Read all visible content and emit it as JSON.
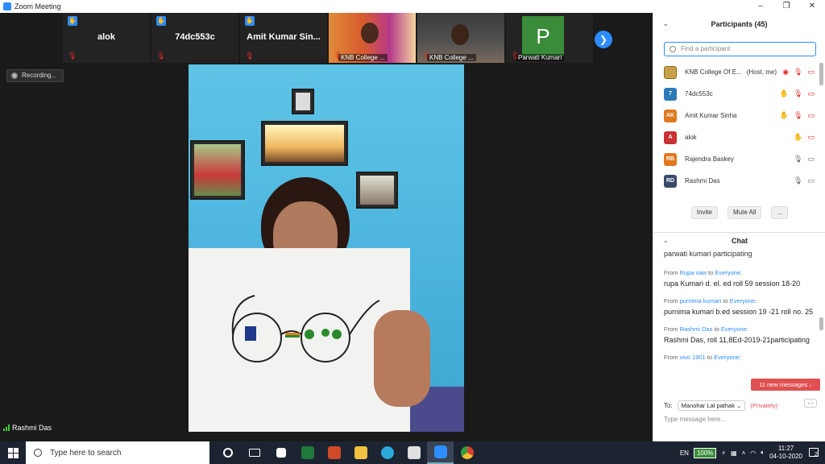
{
  "window": {
    "title": "Zoom Meeting"
  },
  "thumbnails": [
    {
      "name": "alok",
      "hand_raised": true,
      "muted": true
    },
    {
      "name": "74dc553c",
      "hand_raised": true,
      "muted": true
    },
    {
      "name": "Amit Kumar Sin...",
      "hand_raised": true,
      "muted": true
    },
    {
      "name": "KNB College ...",
      "video": true,
      "muted": true
    },
    {
      "name": "KNB College ...",
      "video": true,
      "muted": true
    },
    {
      "name": "Parwati Kumari",
      "initial": "P",
      "muted": true
    }
  ],
  "recording": {
    "label": "Recording..."
  },
  "active_speaker": {
    "name": "Rashmi Das"
  },
  "participants": {
    "title": "Participants (45)",
    "search_placeholder": "Find a participant",
    "list": [
      {
        "avatar": "",
        "name": "KNB College Of E...",
        "tag": "(Host, me)",
        "avatar_color": "#c8a048",
        "icons": [
          "rec",
          "mute",
          "cam-off"
        ]
      },
      {
        "avatar": "7",
        "name": "74dc553c",
        "tag": "",
        "avatar_color": "#2d7ab8",
        "icons": [
          "hand",
          "mute",
          "cam-off"
        ]
      },
      {
        "avatar": "AK",
        "name": "Amit Kumar Sinha",
        "tag": "",
        "avatar_color": "#e0781e",
        "icons": [
          "hand",
          "mute",
          "cam-off"
        ]
      },
      {
        "avatar": "A",
        "name": "alok",
        "tag": "",
        "avatar_color": "#c83232",
        "icons": [
          "hand",
          "cam-off"
        ]
      },
      {
        "avatar": "RB",
        "name": "Rajendra Baskey",
        "tag": "",
        "avatar_color": "#e0781e",
        "icons": [
          "mic",
          "cam-on"
        ]
      },
      {
        "avatar": "RD",
        "name": "Rashmi Das",
        "tag": "",
        "avatar_color": "#3a4a6a",
        "icons": [
          "mic",
          "cam-on"
        ]
      }
    ],
    "invite_label": "Invite",
    "mute_all_label": "Mute All",
    "more_label": "..."
  },
  "chat": {
    "title": "Chat",
    "top_text": "parwati kumari participating",
    "messages": [
      {
        "from": "Rupa saw",
        "to": "Everyone",
        "text": "rupa Kumari d. el. ed  roll 59 session 18-20"
      },
      {
        "from": "purnima kumari",
        "to": "Everyone",
        "text": "purnima kumari b.ed session 19 -21 roll no. 25"
      },
      {
        "from": "Rashmi Das",
        "to": "Everyone",
        "text": "Rashmi Das, roll 11,8Ed-2019-21participating"
      },
      {
        "from": "vivo 1901",
        "to": "Everyone",
        "text": ""
      }
    ],
    "new_messages": "11 new messages ↓",
    "to_label": "To:",
    "to_value": "Manohar Lal pathak",
    "privately": "(Privately)",
    "input_placeholder": "Type message here...",
    "from_word": "From",
    "to_word": "to"
  },
  "taskbar": {
    "search_placeholder": "Type here to search",
    "lang": "EN",
    "battery": "100%",
    "time": "11:27",
    "date": "04-10-2020",
    "notif_count": "2"
  }
}
